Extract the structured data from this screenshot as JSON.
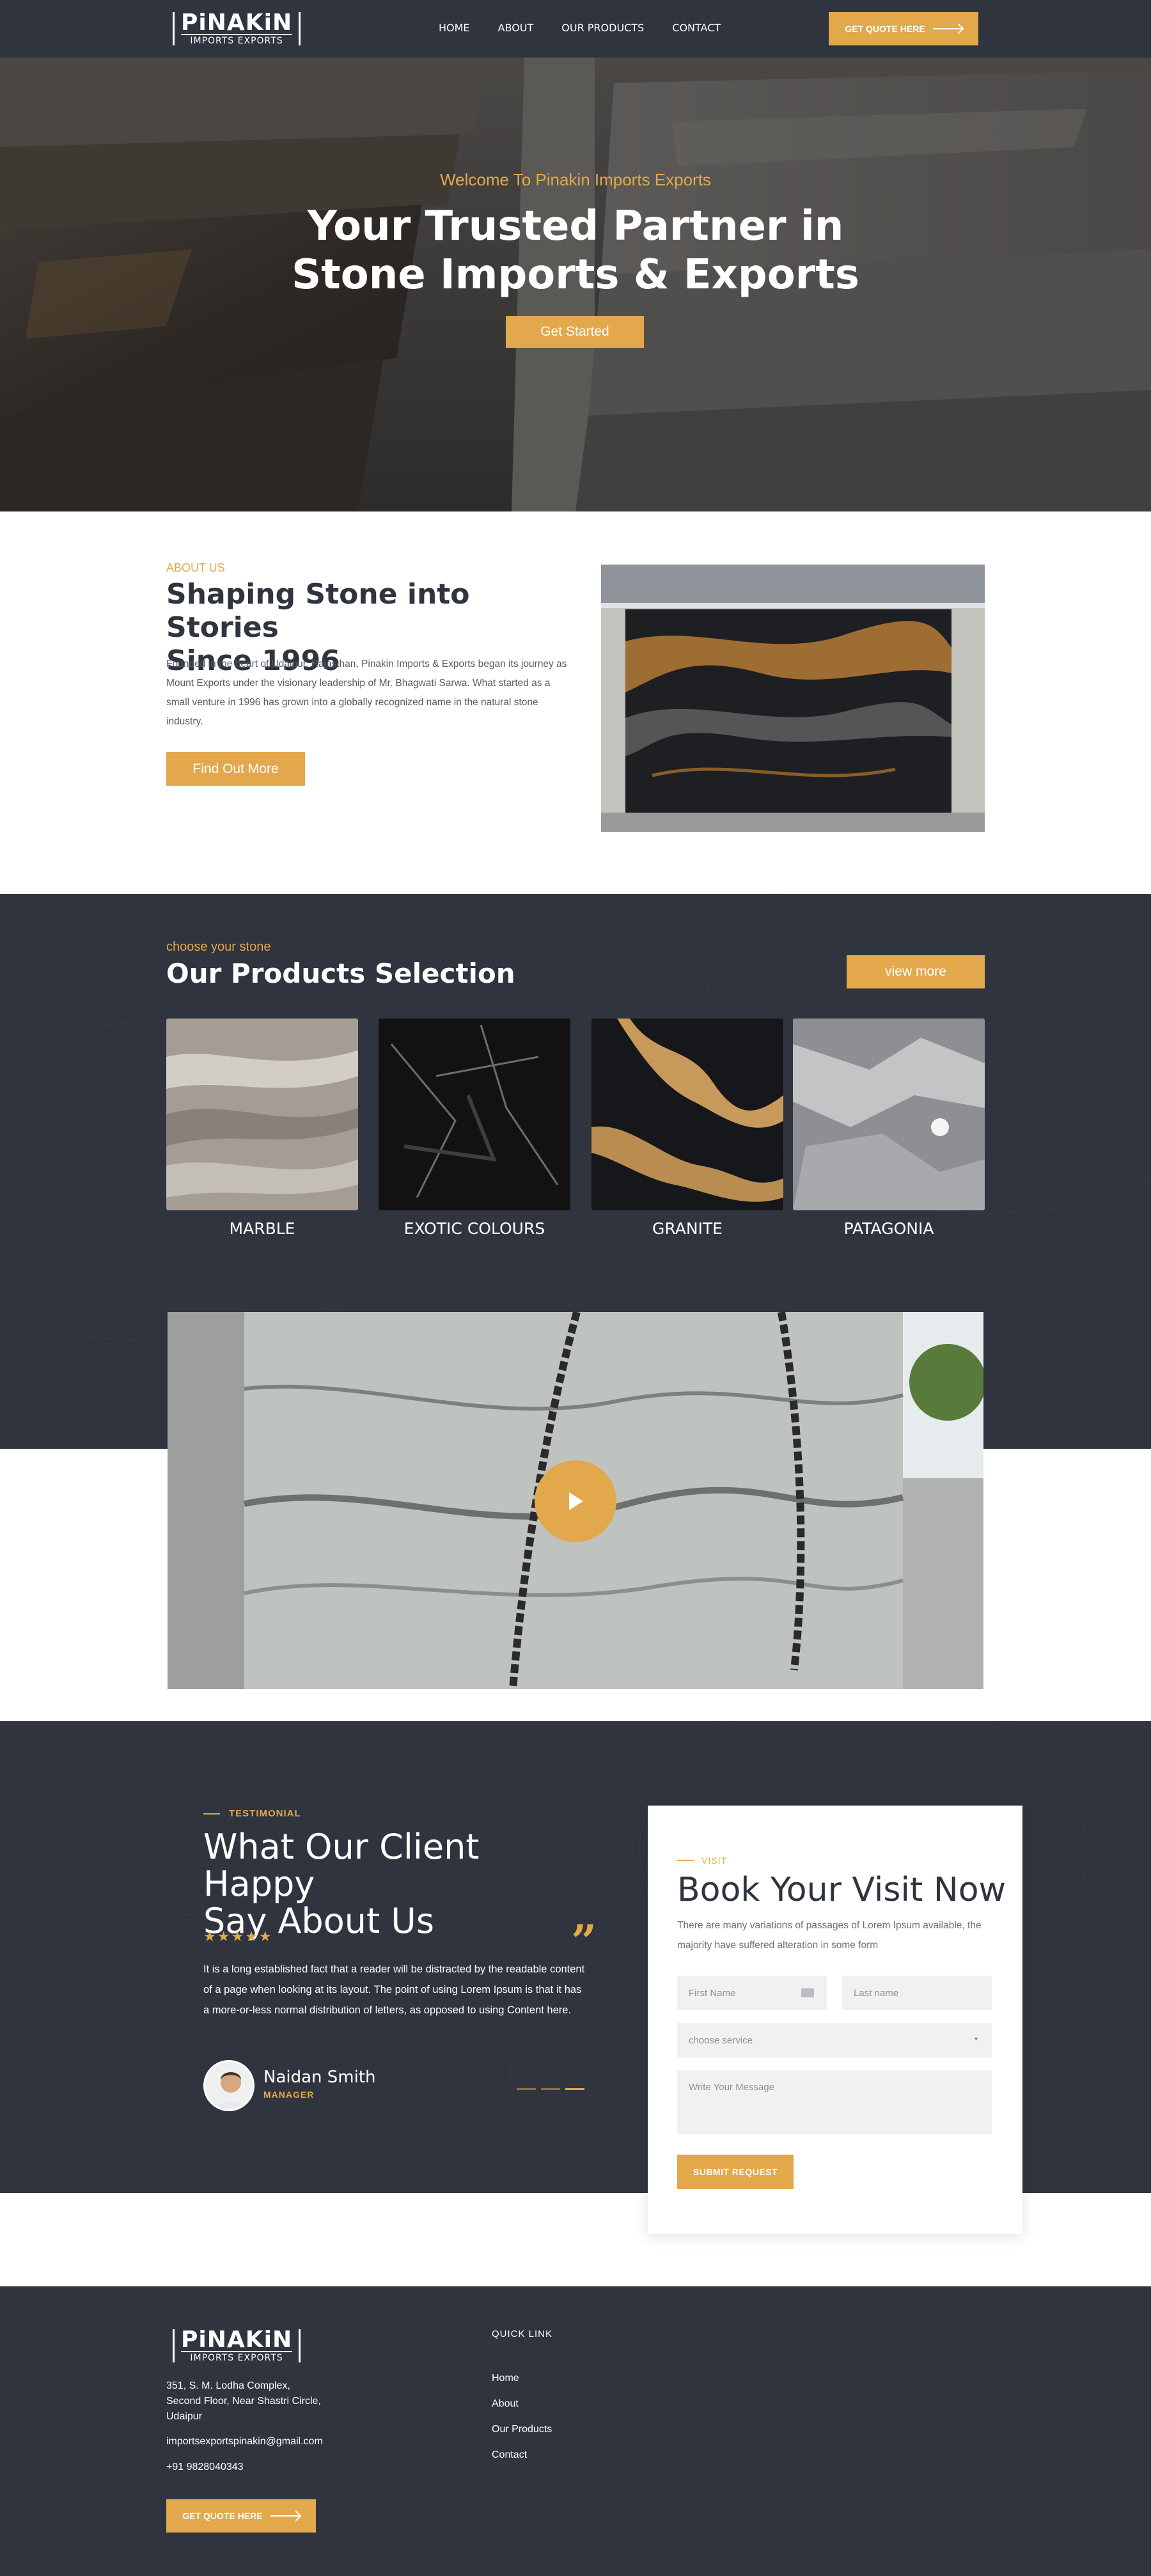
{
  "header": {
    "logo_main": "PiNAKiN",
    "logo_sub": "IMPORTS EXPORTS",
    "nav": [
      "HOME",
      "ABOUT",
      "OUR PRODUCTS",
      "CONTACT"
    ],
    "quote_button": "GET QUOTE HERE"
  },
  "hero": {
    "welcome": "Welcome To Pinakin Imports Exports",
    "title_line1": "Your Trusted Partner in",
    "title_line2": "Stone Imports & Exports",
    "button": "Get Started"
  },
  "about": {
    "label": "ABOUT US",
    "title_line1": "Shaping Stone into Stories",
    "title_line2": "Since 1996",
    "text": "Founded in the heart of Udaipur, Rajasthan, Pinakin Imports & Exports began its journey as Mount Exports under the visionary leadership of Mr. Bhagwati Sarwa. What started as a small venture in 1996 has grown into a globally recognized name in the natural stone industry.",
    "button": "Find Out More"
  },
  "products": {
    "label": "choose your stone",
    "title": "Our Products Selection",
    "button": "view more",
    "items": [
      {
        "name": "MARBLE"
      },
      {
        "name": "EXOTIC COLOURS"
      },
      {
        "name": "GRANITE"
      },
      {
        "name": "PATAGONIA"
      }
    ]
  },
  "testimonial": {
    "label": "TESTIMONIAL",
    "title_line1": "What Our Client Happy",
    "title_line2": "Say About Us",
    "stars": "★★★★★",
    "text": "It is a long established fact that a reader will be distracted by the readable content of a page when looking at its layout. The point of using Lorem Ipsum is that it has a more-or-less normal distribution of letters, as opposed to using Content here.",
    "name": "Naidan Smith",
    "role": "MANAGER"
  },
  "visit_form": {
    "label": "VISIT",
    "title": "Book Your Visit Now",
    "text": "There are many variations of passages of Lorem Ipsum available, the majority have suffered alteration in some form",
    "first_name_placeholder": "First Name",
    "last_name_placeholder": "Last name",
    "service_placeholder": "choose service",
    "message_placeholder": "Write Your Message",
    "submit": "SUBMIT REQUEST"
  },
  "footer": {
    "logo_main": "PiNAKiN",
    "logo_sub": "IMPORTS EXPORTS",
    "address_line1": "351, S. M. Lodha Complex,",
    "address_line2": "Second Floor, Near Shastri Circle,",
    "address_line3": "Udaipur",
    "email": "importsexportspinakin@gmail.com",
    "phone": "+91 9828040343",
    "quote_button": "GET QUOTE HERE",
    "quick_link_title": "QUICK LINK",
    "quick_links": [
      "Home",
      "About",
      "Our Products",
      "Contact"
    ]
  },
  "colors": {
    "accent": "#e2a84b",
    "dark": "#2f343e"
  }
}
